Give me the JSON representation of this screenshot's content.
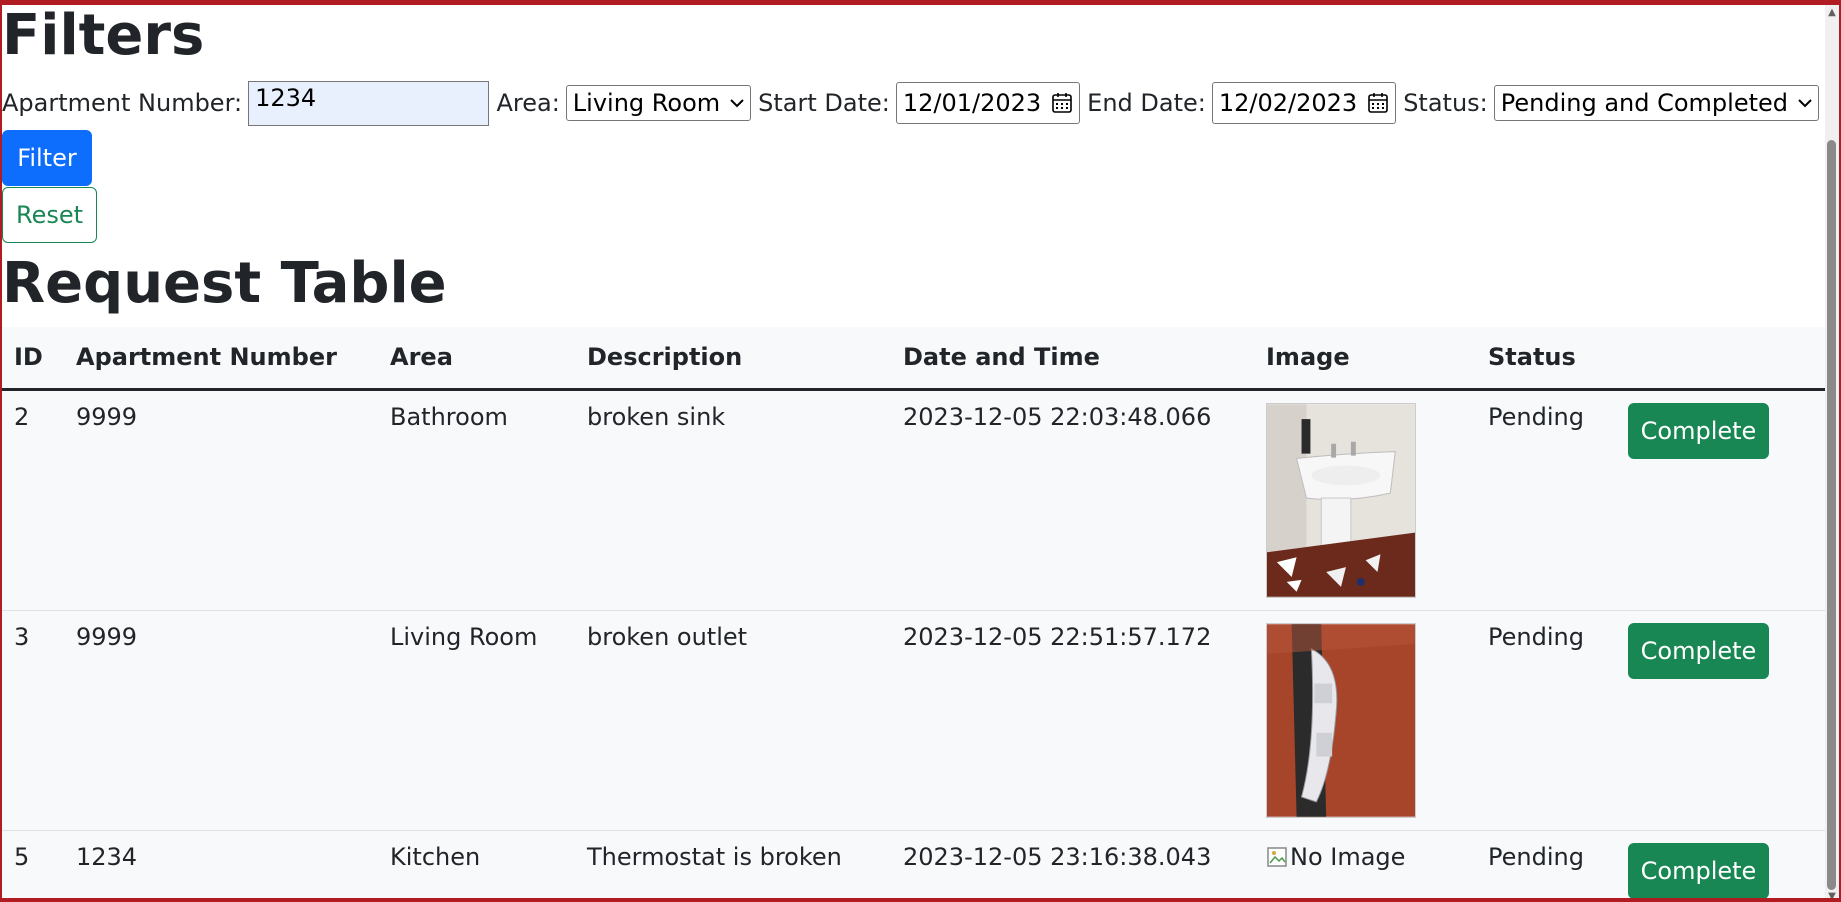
{
  "filters": {
    "title": "Filters",
    "apartment_label": "Apartment Number:",
    "apartment_value": "1234",
    "area_label": "Area:",
    "area_value": "Living Room",
    "start_label": "Start Date:",
    "start_value": "12/01/2023",
    "end_label": "End Date:",
    "end_value": "12/02/2023",
    "status_label": "Status:",
    "status_value": "Pending and Completed",
    "filter_button": "Filter",
    "reset_button": "Reset"
  },
  "table": {
    "title": "Request Table",
    "headers": [
      "ID",
      "Apartment Number",
      "Area",
      "Description",
      "Date and Time",
      "Image",
      "Status"
    ],
    "rows": [
      {
        "id": "2",
        "apartment": "9999",
        "area": "Bathroom",
        "description": "broken sink",
        "datetime": "2023-12-05 22:03:48.066",
        "image": "broken-sink-photo",
        "status": "Pending",
        "action": "Complete"
      },
      {
        "id": "3",
        "apartment": "9999",
        "area": "Living Room",
        "description": "broken outlet",
        "datetime": "2023-12-05 22:51:57.172",
        "image": "broken-outlet-photo",
        "status": "Pending",
        "action": "Complete"
      },
      {
        "id": "5",
        "apartment": "1234",
        "area": "Kitchen",
        "description": "Thermostat is broken",
        "datetime": "2023-12-05 23:16:38.043",
        "image_alt": "No Image",
        "status": "Pending",
        "action": "Complete"
      }
    ]
  },
  "colors": {
    "primary": "#0d6efd",
    "success": "#198754",
    "frame": "#b01c22",
    "text": "#212529"
  }
}
